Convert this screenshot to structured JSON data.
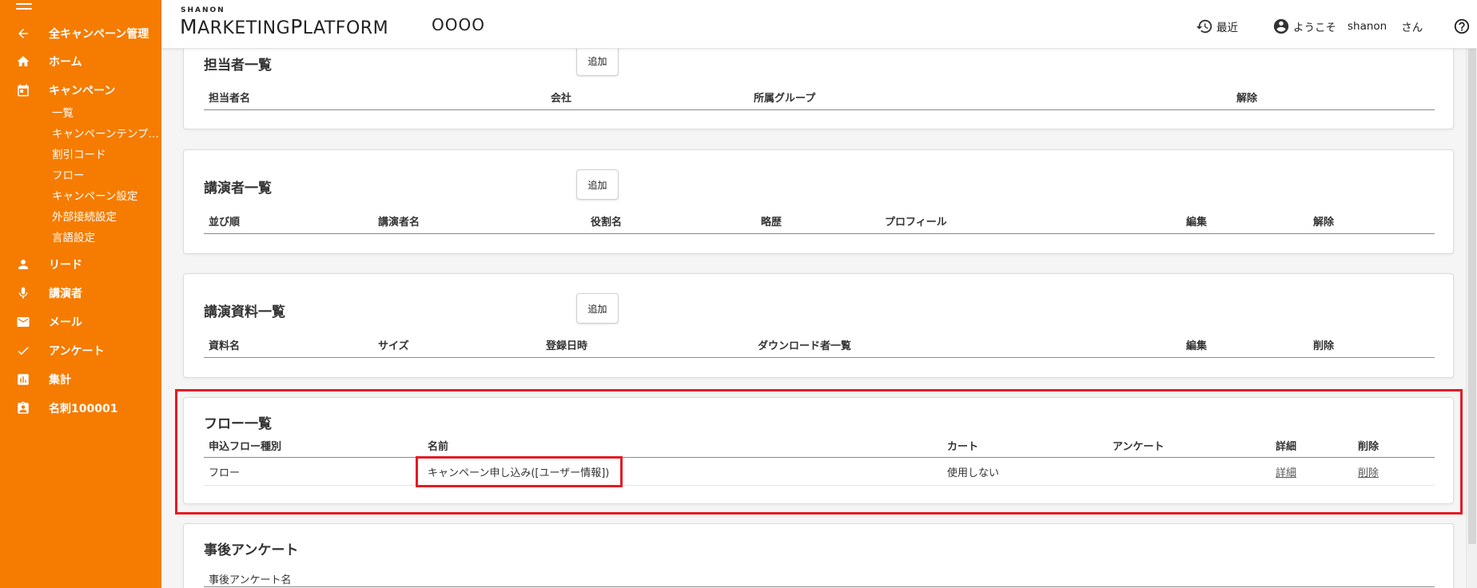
{
  "colors": {
    "sidebar_bg": "#f57c00",
    "highlight": "#e31c23"
  },
  "sidebar": {
    "menu_icon": "hamburger-icon",
    "items": [
      {
        "icon": "arrow-left-icon",
        "label": "全キャンペーン管理"
      },
      {
        "icon": "home-icon",
        "label": "ホーム"
      },
      {
        "icon": "calendar-icon",
        "label": "キャンペーン"
      },
      {
        "icon": "person-icon",
        "label": "リード"
      },
      {
        "icon": "mic-icon",
        "label": "講演者"
      },
      {
        "icon": "mail-icon",
        "label": "メール"
      },
      {
        "icon": "check-icon",
        "label": "アンケート"
      },
      {
        "icon": "bar-chart-icon",
        "label": "集計"
      },
      {
        "icon": "badge-icon",
        "label": "名刺100001"
      }
    ],
    "campaign_sub": [
      "一覧",
      "キャンペーンテンプレート",
      "割引コード",
      "フロー",
      "キャンペーン設定",
      "外部接続設定",
      "言語設定"
    ]
  },
  "header": {
    "logo_top": "SHANON",
    "logo_m": "M",
    "logo_arketing": "ARKETING",
    "logo_p": "P",
    "logo_latform": "LATFORM",
    "app_name": "OOOO",
    "recent_label": "最近",
    "welcome": "ようこそ",
    "user_name": "shanon",
    "honorific": "さん"
  },
  "staff": {
    "title": "担当者一覧",
    "add_label": "追加",
    "columns": [
      "担当者名",
      "会社",
      "所属グループ",
      "解除"
    ]
  },
  "speakers": {
    "title": "講演者一覧",
    "add_label": "追加",
    "columns": [
      "並び順",
      "講演者名",
      "役割名",
      "略歴",
      "プロフィール",
      "編集",
      "解除"
    ]
  },
  "materials": {
    "title": "講演資料一覧",
    "add_label": "追加",
    "columns": [
      "資料名",
      "サイズ",
      "登録日時",
      "ダウンロード者一覧",
      "編集",
      "削除"
    ]
  },
  "flows": {
    "title": "フロー一覧",
    "columns": [
      "申込フロー種別",
      "名前",
      "カート",
      "アンケート",
      "詳細",
      "削除"
    ],
    "rows": [
      {
        "type": "フロー",
        "name": "キャンペーン申し込み([ユーザー情報])",
        "cart": "使用しない",
        "survey": "",
        "detail": "詳細",
        "delete": "削除"
      }
    ]
  },
  "post_survey": {
    "title": "事後アンケート",
    "columns": [
      "事後アンケート名"
    ]
  }
}
